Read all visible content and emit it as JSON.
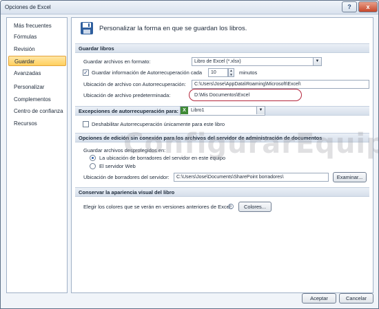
{
  "window": {
    "title": "Opciones de Excel"
  },
  "titlebar": {
    "help_glyph": "?",
    "close_glyph": "x"
  },
  "sidebar": {
    "items": [
      {
        "label": "Más frecuentes"
      },
      {
        "label": "Fórmulas"
      },
      {
        "label": "Revisión"
      },
      {
        "label": "Guardar",
        "active": true
      },
      {
        "label": "Avanzadas"
      },
      {
        "label": "Personalizar"
      },
      {
        "label": "Complementos"
      },
      {
        "label": "Centro de confianza"
      },
      {
        "label": "Recursos"
      }
    ]
  },
  "header": {
    "text": "Personalizar la forma en que se guardan los libros.",
    "icon": "save-disk-icon"
  },
  "save_section": {
    "title": "Guardar libros",
    "format_label": "Guardar archivos en formato:",
    "format_value": "Libro de Excel (*.xlsx)",
    "autorecover_label": "Guardar información de Autorrecuperación cada",
    "autorecover_checked": true,
    "autorecover_minutes": "10",
    "minutes_label": "minutos",
    "autorecover_location_label": "Ubicación de archivo con Autorrecuperación:",
    "autorecover_location_value": "C:\\Users\\Jose\\AppData\\Roaming\\Microsoft\\Excel\\",
    "default_location_label": "Ubicación de archivo predeterminada:",
    "default_location_value": "D:\\Mis Documentos\\Excel"
  },
  "exceptions_section": {
    "title": "Excepciones de autorrecuperación para:",
    "workbook_value": "Libro1",
    "disable_label": "Deshabilitar Autorrecuperación únicamente para este libro",
    "disable_checked": false
  },
  "offline_section": {
    "title": "Opciones de edición sin conexión para los archivos del servidor de administración de documentos",
    "save_checkedout_label": "Guardar archivos desprotegidos en:",
    "option_drafts": "La ubicación de borradores del servidor en este equipo",
    "option_web": "El servidor Web",
    "selected_option": "drafts",
    "drafts_location_label": "Ubicación de borradores del servidor:",
    "drafts_location_value": "C:\\Users\\Jose\\Documents\\SharePoint borradores\\",
    "browse_label": "Examinar..."
  },
  "visual_section": {
    "title": "Conservar la apariencia visual del libro",
    "colors_label": "Elegir los colores que se verán en versiones anteriores de Excel:",
    "colors_button": "Colores..."
  },
  "footer": {
    "ok_label": "Aceptar",
    "cancel_label": "Cancelar"
  },
  "watermark": {
    "text": "ConfigurarEquipos"
  }
}
